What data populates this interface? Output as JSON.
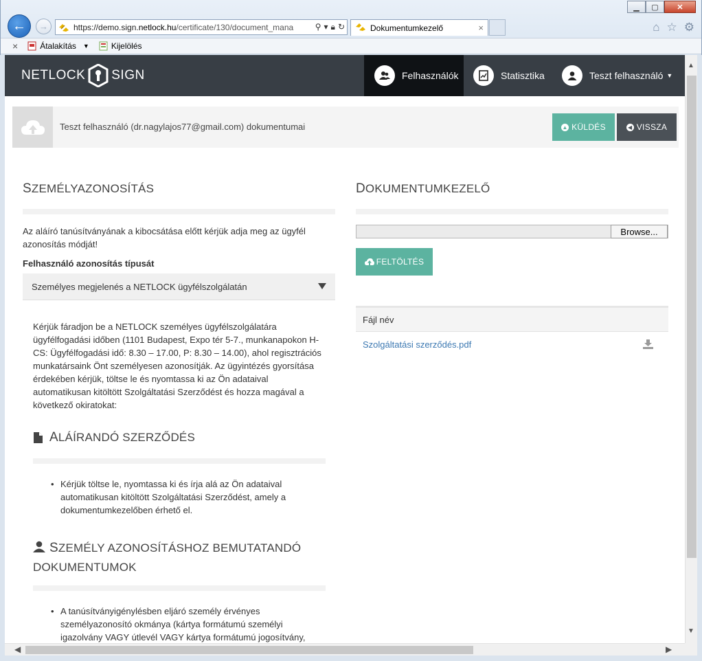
{
  "browser": {
    "url_prefix": "https://demo.sign.",
    "url_domain": "netlock.hu",
    "url_path": "/certificate/130/document_mana",
    "tab_title": "Dokumentumkezelő",
    "tab_close": "×",
    "cmd_close": "×",
    "cmd_convert": "Átalakítás",
    "cmd_select": "Kijelölés"
  },
  "nav": {
    "logo_left": "NETLOCK",
    "logo_right": "SIGN",
    "users": "Felhasználók",
    "stats": "Statisztika",
    "user_menu": "Teszt felhasználó"
  },
  "header": {
    "title": "Teszt felhasználó (dr.nagylajos77@gmail.com) dokumentumai",
    "send_label": "KÜLDÉS",
    "back_label": "VISSZA"
  },
  "left": {
    "title_cap": "S",
    "title_rest": "ZEMÉLYAZONOSÍTÁS",
    "intro": "Az aláíró tanúsítványának a kibocsátása előtt kérjük adja meg az ügyfél azonosítás módját!",
    "id_type_label": "Felhasználó azonosítás típusát",
    "id_type_value": "Személyes megjelenés a NETLOCK ügyfélszolgálatán",
    "description": "Kérjük fáradjon be a NETLOCK személyes ügyfélszolgálatára ügyfélfogadási időben (1101 Budapest, Expo tér 5-7., munkanapokon H-CS: Ügyfélfogadási idő: 8.30 – 17.00, P: 8.30 – 14.00), ahol regisztrációs munkatársaink Önt személyesen azonosítják. Az ügyintézés gyorsítása érdekében kérjük, töltse le és nyomtassa ki az Ön adataival automatikusan kitöltött Szolgáltatási Szerződést és hozza magával a következő okiratokat:",
    "contract_cap": "A",
    "contract_rest": "LÁÍRANDÓ SZERZŐDÉS",
    "contract_item": "Kérjük töltse le, nyomtassa ki és írja alá az Ön adataival automatikusan kitöltött Szolgáltatási Szerződést, amely a dokumentumkezelőben érhető el.",
    "docs_cap": "S",
    "docs_rest": "ZEMÉLY AZONOSÍTÁSHOZ BEMUTATANDÓ DOKUMENTUMOK",
    "docs_item": "A tanúsítványigénylésben eljáró személy érvényes személyazonosító okmánya (kártya formátumú személyi igazolvány VAGY útlevél VAGY kártya formátumú jogosítvány,"
  },
  "right": {
    "title_cap": "D",
    "title_rest": "OKUMENTUMKEZELŐ",
    "browse_label": "Browse...",
    "upload_label": "FELTÖLTÉS",
    "table_header": "Fájl név",
    "files": [
      "Szolgáltatási szerződés.pdf"
    ]
  },
  "colors": {
    "nav_bg": "#383e45",
    "accent_green": "#5cb3a0",
    "back_btn": "#4b5157",
    "link": "#3d79b2"
  }
}
